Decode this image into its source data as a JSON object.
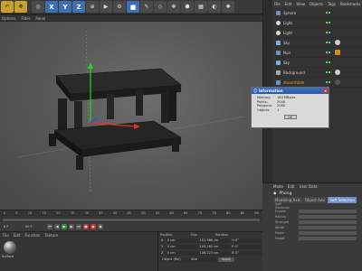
{
  "toolbar": {
    "axis_x": "X",
    "axis_y": "Y",
    "axis_z": "Z"
  },
  "view_menu": [
    "Options",
    "Filter",
    "Panel"
  ],
  "om_menu": [
    "File",
    "Edit",
    "View",
    "Objects",
    "Tags",
    "Bookmarks"
  ],
  "objects": [
    {
      "label": "Sphere",
      "icon": "sphere-icon"
    },
    {
      "label": "Light",
      "icon": "light-icon"
    },
    {
      "label": "Light",
      "icon": "light-icon"
    },
    {
      "label": "Sky",
      "icon": "sky-icon"
    },
    {
      "label": "Null",
      "icon": "null-icon"
    },
    {
      "label": "Sky",
      "icon": "sky-icon"
    },
    {
      "label": "Background",
      "icon": "background-icon"
    },
    {
      "label": "dossertable",
      "icon": "polygon-icon",
      "selected": true
    }
  ],
  "info": {
    "title": "Information",
    "rows": [
      {
        "k": "Memory:",
        "v": "180 MBytes"
      },
      {
        "k": "Points:",
        "v": "2048"
      },
      {
        "k": "Polygons:",
        "v": "2064"
      },
      {
        "k": "Objects:",
        "v": "1"
      }
    ],
    "ok": "OK"
  },
  "attr": {
    "menu": [
      "Mode",
      "Edit",
      "User Data"
    ],
    "title": "Phong",
    "tabs": [
      "Modeling Axis",
      "Object Axis",
      "Soft Selection"
    ],
    "section": "Soft Selection",
    "rows": [
      "Enable",
      "Radius",
      "Strength",
      "Width",
      "Mode",
      "Falloff"
    ]
  },
  "timeline": {
    "ticks": [
      "0",
      "5",
      "10",
      "15",
      "20",
      "25",
      "30",
      "35",
      "40",
      "45",
      "50",
      "55",
      "60",
      "65",
      "70",
      "75",
      "80",
      "85",
      "90"
    ]
  },
  "transport": {
    "frame_start": "0 F",
    "frame_end": "90 F"
  },
  "material": {
    "menu": [
      "File",
      "Edit",
      "Function",
      "Texture"
    ],
    "name": "Surface"
  },
  "coords": {
    "headers": [
      "Position",
      "Size",
      "Rotation"
    ],
    "rows": [
      {
        "axis": "X",
        "pos": "0 cm",
        "size": "101.986 cm",
        "rot": "H 0°"
      },
      {
        "axis": "Y",
        "pos": "0 cm",
        "size": "103.262 cm",
        "rot": "P 0°"
      },
      {
        "axis": "Z",
        "pos": "0 cm",
        "size": "106.223 cm",
        "rot": "B 0°"
      }
    ],
    "mode": "Object (Rel)",
    "size_mode": "Size",
    "apply": "Apply"
  },
  "colors": {
    "accent": "#6a8fc9",
    "selected_obj": "#f0a030",
    "x_axis": "#e03030",
    "y_axis": "#30d030",
    "z_axis": "#3050e0"
  }
}
